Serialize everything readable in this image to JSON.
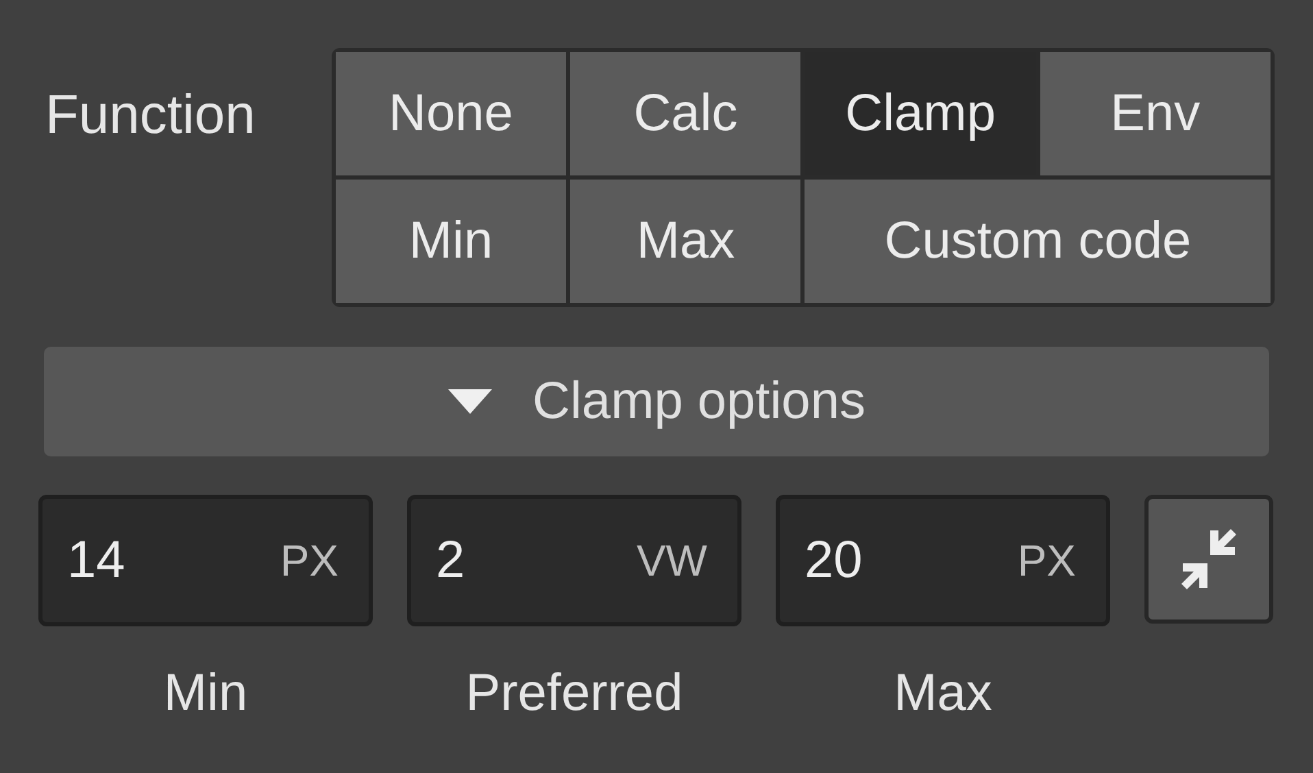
{
  "function": {
    "label": "Function",
    "options": [
      {
        "label": "None",
        "selected": false
      },
      {
        "label": "Calc",
        "selected": false
      },
      {
        "label": "Clamp",
        "selected": true
      },
      {
        "label": "Env",
        "selected": false
      },
      {
        "label": "Min",
        "selected": false
      },
      {
        "label": "Max",
        "selected": false
      },
      {
        "label": "Custom code",
        "selected": false
      }
    ]
  },
  "clamp_options": {
    "label": "Clamp options",
    "expanded": true
  },
  "fields": [
    {
      "value": "14",
      "unit": "PX",
      "label": "Min"
    },
    {
      "value": "2",
      "unit": "VW",
      "label": "Preferred"
    },
    {
      "value": "20",
      "unit": "PX",
      "label": "Max"
    }
  ]
}
